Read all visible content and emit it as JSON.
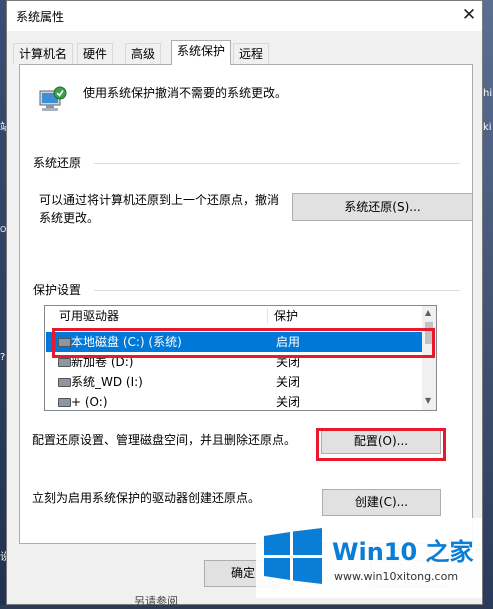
{
  "window": {
    "title": "系统属性",
    "close_glyph": "✕"
  },
  "tabs": [
    {
      "label": "计算机名"
    },
    {
      "label": "硬件"
    },
    {
      "label": "高级"
    },
    {
      "label": "系统保护"
    },
    {
      "label": "远程"
    }
  ],
  "intro": {
    "text": "使用系统保护撤消不需要的系统更改。",
    "icon": "computer-shield-icon"
  },
  "restore": {
    "heading": "系统还原",
    "description_line1": "可以通过将计算机还原到上一个还原点，撤消",
    "description_line2": "系统更改。",
    "button": "系统还原(S)..."
  },
  "protection": {
    "heading": "保护设置",
    "columns": [
      "可用驱动器",
      "保护"
    ],
    "rows": [
      {
        "name": "本地磁盘 (C:) (系统)",
        "status": "启用",
        "selected": true
      },
      {
        "name": "新加卷 (D:)",
        "status": "关闭",
        "selected": false
      },
      {
        "name": "系统_WD (I:)",
        "status": "关闭",
        "selected": false
      },
      {
        "name": "+ (O:)",
        "status": "关闭",
        "selected": false
      }
    ]
  },
  "configure": {
    "text": "配置还原设置、管理磁盘空间，并且删除还原点。",
    "button": "配置(O)..."
  },
  "create": {
    "text": "立刻为启用系统保护的驱动器创建还原点。",
    "button": "创建(C)..."
  },
  "footer": {
    "ok_button": "确定"
  },
  "desktop": {
    "left_chars": [
      "站",
      "ON",
      "?",
      "设"
    ],
    "right_chars": [
      "hi",
      "ki"
    ],
    "bottom_text": "另请参阅"
  },
  "watermark": {
    "brand": "Win10 之家",
    "url": "www.win10xitong.com"
  },
  "colors": {
    "selection": "#0078d7",
    "highlight_box": "#e8192c",
    "win_logo": "#0a7ed6"
  }
}
